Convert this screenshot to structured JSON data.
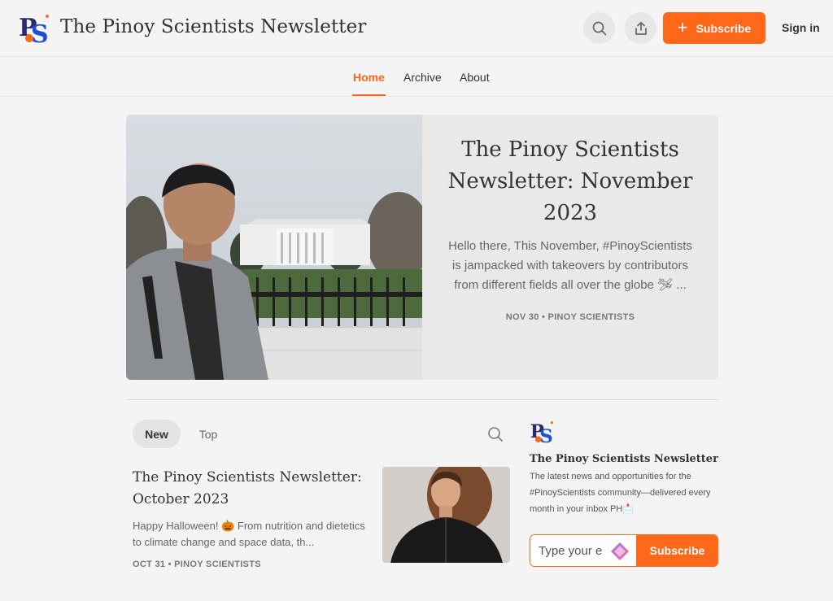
{
  "header": {
    "title": "The Pinoy Scientists Newsletter",
    "logo_text": "PS",
    "subscribe_label": "Subscribe",
    "signin_label": "Sign in"
  },
  "nav": {
    "items": [
      {
        "label": "Home",
        "active": true
      },
      {
        "label": "Archive"
      },
      {
        "label": "About"
      }
    ]
  },
  "featured": {
    "title": "The Pinoy Scientists Newsletter: November 2023",
    "description": "Hello there, This November, #PinoyScientists is jampacked with takeovers by contributors from different fields all over the globe 🛩 ...",
    "meta": "NOV 30 • PINOY SCIENTISTS"
  },
  "tabs": [
    {
      "label": "New",
      "active": true
    },
    {
      "label": "Top"
    }
  ],
  "posts": [
    {
      "title": "The Pinoy Scientists Newsletter: October 2023",
      "description": "Happy Halloween! 🎃 From nutrition and dietetics to climate change and space data, th...",
      "meta": "OCT 31 • PINOY SCIENTISTS"
    }
  ],
  "sidebar": {
    "title": "The Pinoy Scientists Newsletter",
    "description": "The latest news and opportunities for the #PinoyScientists community—delivered every month in your inbox PH📩",
    "email_placeholder": "Type your e",
    "subscribe_label": "Subscribe"
  },
  "colors": {
    "accent": "#ff6719",
    "logo_blue": "#1d4fd8",
    "background": "#f4f4f4"
  },
  "icons": [
    "search-icon",
    "share-icon",
    "plus-icon",
    "gem-icon"
  ]
}
